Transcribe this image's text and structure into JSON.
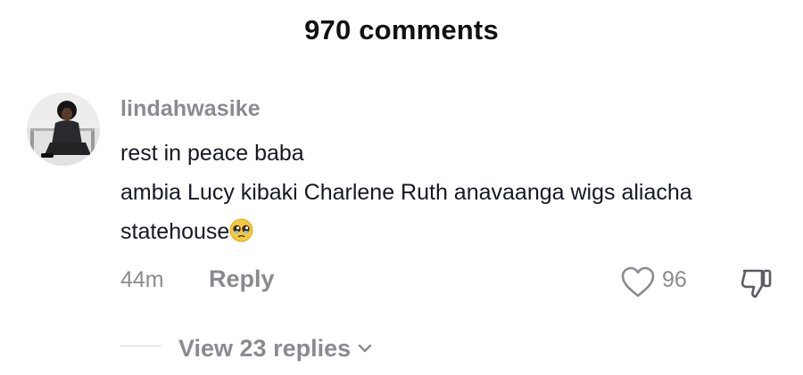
{
  "header": {
    "title": "970 comments"
  },
  "comment": {
    "username": "lindahwasike",
    "lines": [
      "rest in peace baba",
      "ambia Lucy kibaki Charlene Ruth anavaanga wigs aliacha",
      "statehouse"
    ],
    "emoji": "pleading-face-emoji",
    "time": "44m",
    "reply_label": "Reply",
    "like_count": "96",
    "view_replies_label": "View 23 replies"
  },
  "icons": {
    "like": "heart-outline-icon",
    "dislike": "thumbs-down-icon",
    "expand": "chevron-down-icon"
  },
  "colors": {
    "text": "#161823",
    "muted": "#8a8b91"
  }
}
